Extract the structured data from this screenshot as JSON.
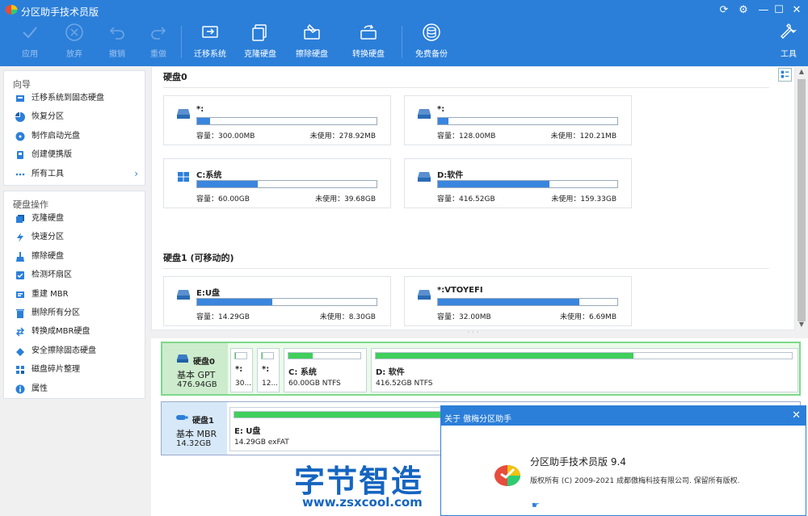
{
  "app": {
    "title": "分区助手技术员版"
  },
  "toolbar": {
    "apply": "应用",
    "discard": "放弃",
    "undo": "撤销",
    "redo": "重做",
    "migrate": "迁移系统",
    "clone": "克隆硬盘",
    "wipe": "擦除硬盘",
    "convert": "转换硬盘",
    "backup": "免费备份",
    "tools": "工具"
  },
  "sidebar": {
    "wizard_title": "向导",
    "wizard_items": [
      {
        "label": "迁移系统到固态硬盘",
        "icon": "ssd-migrate-icon"
      },
      {
        "label": "恢复分区",
        "icon": "pie-recover-icon"
      },
      {
        "label": "制作启动光盘",
        "icon": "boot-disc-icon"
      },
      {
        "label": "创建便携版",
        "icon": "portable-icon"
      },
      {
        "label": "所有工具",
        "icon": "all-tools-icon"
      }
    ],
    "ops_title": "硬盘操作",
    "ops_items": [
      {
        "label": "克隆硬盘",
        "icon": "clone-disk-icon"
      },
      {
        "label": "快速分区",
        "icon": "lightning-icon"
      },
      {
        "label": "擦除硬盘",
        "icon": "eraser-icon"
      },
      {
        "label": "检测坏扇区",
        "icon": "check-sector-icon"
      },
      {
        "label": "重建 MBR",
        "icon": "rebuild-mbr-icon"
      },
      {
        "label": "删除所有分区",
        "icon": "trash-icon"
      },
      {
        "label": "转换成MBR硬盘",
        "icon": "convert-icon"
      },
      {
        "label": "安全擦除固态硬盘",
        "icon": "ssd-erase-icon"
      },
      {
        "label": "磁盘碎片整理",
        "icon": "defrag-icon"
      },
      {
        "label": "属性",
        "icon": "info-icon"
      }
    ]
  },
  "disks": [
    {
      "header": "硬盘0",
      "partitions": [
        {
          "name": "*:",
          "capacity": "容量：300.00MB",
          "free": "未使用：278.92MB",
          "used": 0.07,
          "icon": "drive-icon"
        },
        {
          "name": "*:",
          "capacity": "容量：128.00MB",
          "free": "未使用：120.21MB",
          "used": 0.06,
          "icon": "drive-icon"
        },
        {
          "name": "C:系统",
          "capacity": "容量：60.00GB",
          "free": "未使用：39.68GB",
          "used": 0.34,
          "icon": "windows-icon"
        },
        {
          "name": "D:软件",
          "capacity": "容量：416.52GB",
          "free": "未使用：159.33GB",
          "used": 0.62,
          "icon": "drive-icon"
        }
      ]
    },
    {
      "header": "硬盘1 (可移动的)",
      "partitions": [
        {
          "name": "E:U盘",
          "capacity": "容量：14.29GB",
          "free": "未使用：8.30GB",
          "used": 0.42,
          "icon": "drive-icon"
        },
        {
          "name": "*:VTOYEFI",
          "capacity": "容量：32.00MB",
          "free": "未使用：6.69MB",
          "used": 0.79,
          "icon": "drive-icon"
        }
      ]
    }
  ],
  "diskmap": [
    {
      "title": "硬盘0",
      "type": "基本 GPT",
      "size": "476.94GB",
      "parts": [
        {
          "name": "*:",
          "size": "30...",
          "used": 0.07
        },
        {
          "name": "*:",
          "size": "12...",
          "used": 0.06
        },
        {
          "name": "C: 系统",
          "size": "60.00GB NTFS",
          "used": 0.34
        },
        {
          "name": "D: 软件",
          "size": "416.52GB NTFS",
          "used": 0.62
        }
      ]
    },
    {
      "title": "硬盘1",
      "type": "基本 MBR",
      "size": "14.32GB",
      "parts": [
        {
          "name": "E: U盘",
          "size": "14.29GB exFAT",
          "used": 0.42
        }
      ]
    }
  ],
  "about": {
    "title": "关于 傲梅分区助手",
    "product": "分区助手技术员版 9.4",
    "copyright": "版权所有 (C) 2009-2021 成都傲梅科技有限公司. 保留所有版权."
  },
  "watermark": {
    "text": "字节智造",
    "url": "www.zsxcool.com"
  },
  "colors": {
    "accent": "#2b7fd9",
    "bar": "#3a86de",
    "green": "#3fcf5c"
  }
}
